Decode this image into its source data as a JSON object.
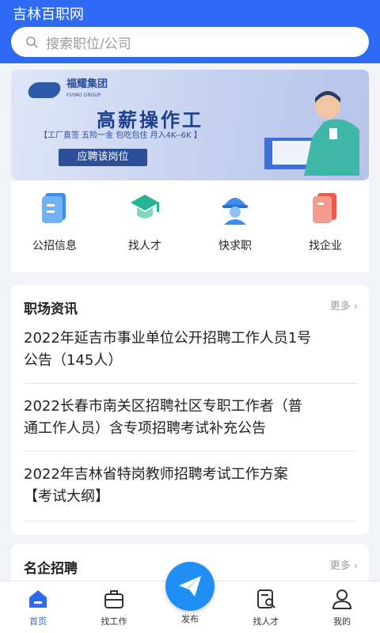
{
  "app": {
    "title": "吉林百职网"
  },
  "search": {
    "placeholder": "搜索职位/公司"
  },
  "banner": {
    "company": "福耀集团",
    "company_en": "FUYAO GROUP",
    "title": "高薪操作工",
    "subtitle": "【工厂直签 五险一金 包吃包住 月入4K--6K 】",
    "button": "应聘该岗位"
  },
  "quick_links": [
    {
      "label": "公招信息",
      "icon": "document-icon"
    },
    {
      "label": "找人才",
      "icon": "graduation-cap-icon"
    },
    {
      "label": "快求职",
      "icon": "worker-helmet-icon"
    },
    {
      "label": "找企业",
      "icon": "company-card-icon"
    }
  ],
  "news": {
    "title": "职场资讯",
    "more": "更多",
    "items": [
      {
        "line1": "2022年延吉市事业单位公开招聘工作人员1号",
        "line2": "公告（145人）"
      },
      {
        "line1": "2022长春市南关区招聘社区专职工作者（普",
        "line2": "通工作人员）含专项招聘考试补充公告"
      },
      {
        "line1": "2022年吉林省特岗教师招聘考试工作方案",
        "line2": "【考试大纲】"
      }
    ]
  },
  "companies": {
    "title": "名企招聘",
    "more": "更多"
  },
  "tabbar": {
    "active_color": "#2f6af5",
    "tabs": [
      {
        "label": "首页",
        "icon": "home-icon"
      },
      {
        "label": "找工作",
        "icon": "briefcase-icon"
      },
      {
        "label": "发布",
        "icon": "paper-plane-icon"
      },
      {
        "label": "找人才",
        "icon": "resume-search-icon"
      },
      {
        "label": "我的",
        "icon": "user-icon"
      }
    ]
  },
  "colors": {
    "primary": "#2f6af5",
    "publish": "#1f8ef5"
  }
}
